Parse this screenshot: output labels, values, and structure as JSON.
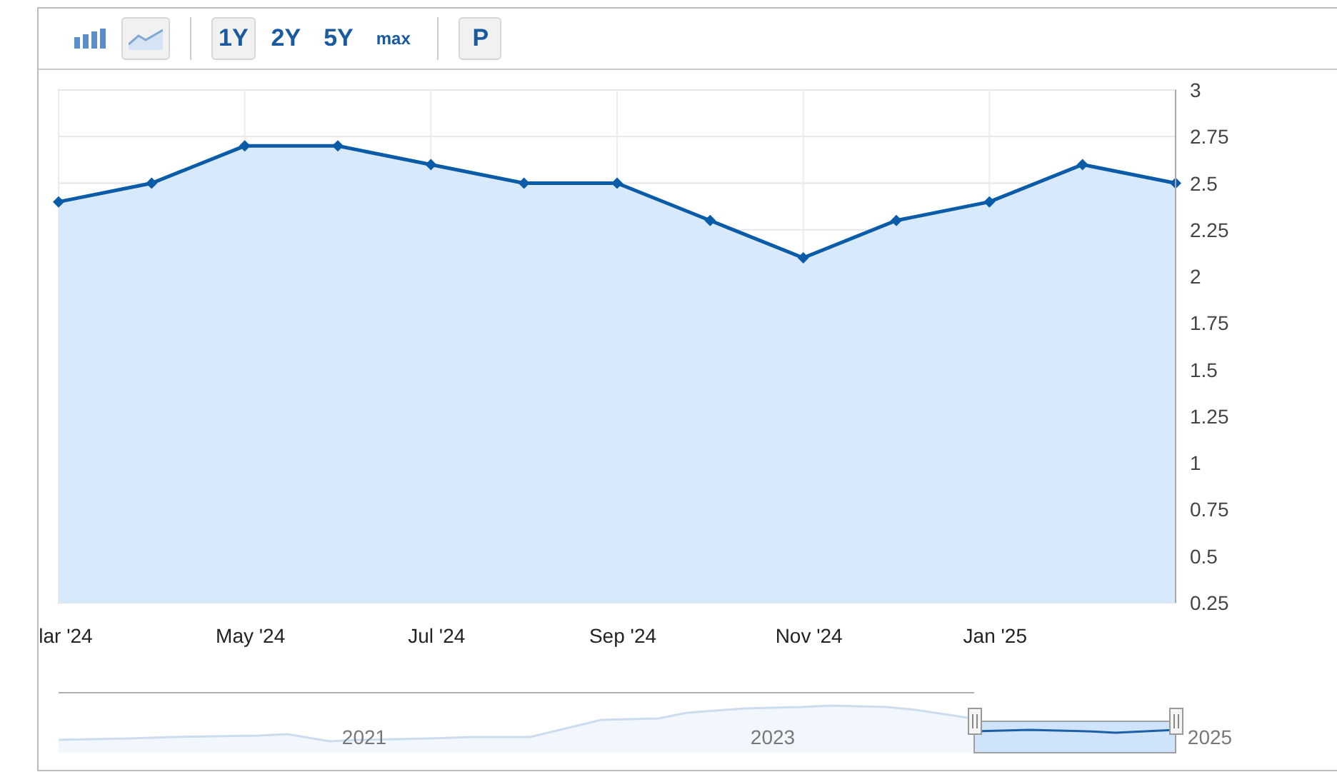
{
  "toolbar": {
    "chart_types": [
      {
        "kind": "bar",
        "selected": false
      },
      {
        "kind": "line",
        "selected": true
      }
    ],
    "ranges": [
      {
        "label": "1Y",
        "selected": true
      },
      {
        "label": "2Y",
        "selected": false
      },
      {
        "label": "5Y",
        "selected": false
      },
      {
        "label": "max",
        "selected": false
      }
    ],
    "p_button": {
      "label": "P",
      "selected": true
    }
  },
  "chart": {
    "chart_data": {
      "type": "area",
      "categories": [
        "lar '24",
        null,
        "May '24",
        null,
        "Jul '24",
        null,
        "Sep '24",
        null,
        "Nov '24",
        null,
        "Jan '25",
        null,
        null
      ],
      "series": [
        {
          "color": "#0b5ca8",
          "values": [
            2.4,
            2.5,
            2.7,
            2.7,
            2.6,
            2.5,
            2.5,
            2.3,
            2.1,
            2.3,
            2.4,
            2.6,
            2.5
          ]
        }
      ],
      "ylim": [
        0.25,
        3
      ],
      "grid": true,
      "yticks": [
        {
          "value": 3,
          "label": "3"
        },
        {
          "value": 2.75,
          "label": "2.75"
        },
        {
          "value": 2.5,
          "label": "2.5"
        },
        {
          "value": 2.25,
          "label": "2.25"
        },
        {
          "value": 2,
          "label": "2"
        },
        {
          "value": 1.75,
          "label": "1.75"
        },
        {
          "value": 1.5,
          "label": "1.5"
        },
        {
          "value": 1.25,
          "label": "1.25"
        },
        {
          "value": 1,
          "label": "1"
        },
        {
          "value": 0.75,
          "label": "0.75"
        },
        {
          "value": 0.5,
          "label": "0.5"
        },
        {
          "value": 0.25,
          "label": "0.25"
        }
      ]
    }
  },
  "navigator": {
    "year_labels": [
      "2021",
      "2023",
      "2025"
    ]
  }
}
